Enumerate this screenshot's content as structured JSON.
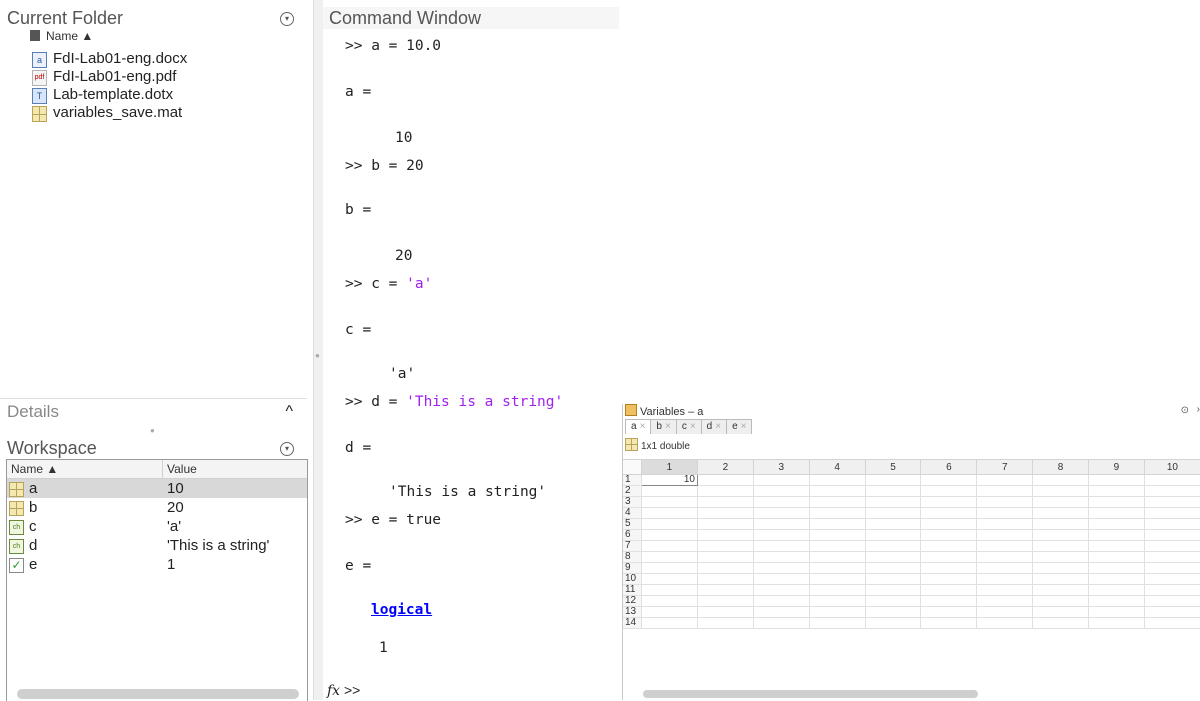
{
  "current_folder": {
    "title": "Current Folder",
    "collapse_icon": "circle-chevron-down-icon",
    "column_header": "Name ▲",
    "files": [
      {
        "name": "FdI-Lab01-eng.docx",
        "icon": "word-doc-icon"
      },
      {
        "name": "FdI-Lab01-eng.pdf",
        "icon": "pdf-file-icon"
      },
      {
        "name": "Lab-template.dotx",
        "icon": "word-template-icon"
      },
      {
        "name": "variables_save.mat",
        "icon": "mat-file-icon"
      }
    ]
  },
  "details": {
    "title": "Details",
    "toggle": "^"
  },
  "workspace": {
    "title": "Workspace",
    "columns": {
      "name": "Name ▲",
      "value": "Value"
    },
    "variables": [
      {
        "name": "a",
        "value": "10",
        "icon": "numeric-array-icon",
        "selected": true
      },
      {
        "name": "b",
        "value": "20",
        "icon": "numeric-array-icon",
        "selected": false
      },
      {
        "name": "c",
        "value": "'a'",
        "icon": "char-array-icon",
        "selected": false
      },
      {
        "name": "d",
        "value": "'This is a string'",
        "icon": "char-array-icon",
        "selected": false
      },
      {
        "name": "e",
        "value": "1",
        "icon": "logical-checkbox-icon",
        "selected": false
      }
    ]
  },
  "command_window": {
    "title": "Command Window",
    "lines": {
      "l1": ">> a = 10.0",
      "l2": "a =",
      "l3": "10",
      "l4": ">> b = 20",
      "l5": "b =",
      "l6": "20",
      "l7_prefix": ">> c = ",
      "l7_str": "'a'",
      "l8": "c =",
      "l9": "'a'",
      "l10_prefix": ">> d = ",
      "l10_str": "'This is a string'",
      "l11": "d =",
      "l12": "'This is a string'",
      "l13": ">> e = true",
      "l14": "e =",
      "l15_link": "logical",
      "l16": "1"
    },
    "prompt_fx": "fx",
    "prompt": " >>"
  },
  "variables_editor": {
    "title": "Variables – a",
    "tabs": [
      "a",
      "b",
      "c",
      "d",
      "e"
    ],
    "active_tab": "a",
    "size_label": "1x1 double",
    "columns": [
      "1",
      "2",
      "3",
      "4",
      "5",
      "6",
      "7",
      "8",
      "9",
      "10"
    ],
    "rows": [
      "1",
      "2",
      "3",
      "4",
      "5",
      "6",
      "7",
      "8",
      "9",
      "10",
      "11",
      "12",
      "13",
      "14"
    ],
    "cell_value": "10",
    "close_label": "×",
    "menu_icon": "circle-chevron-down-icon"
  }
}
